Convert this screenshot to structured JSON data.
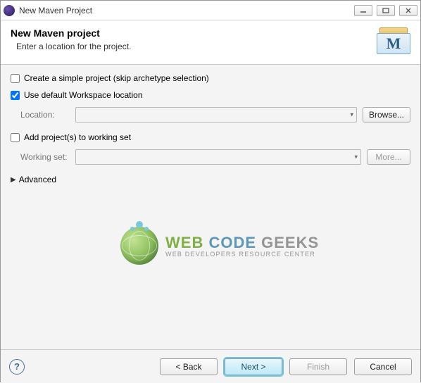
{
  "window": {
    "title": "New Maven Project"
  },
  "header": {
    "title": "New Maven project",
    "subtitle": "Enter a location for the project.",
    "icon_letter": "M"
  },
  "options": {
    "simple_project": {
      "label": "Create a simple project (skip archetype selection)",
      "checked": false
    },
    "default_workspace": {
      "label": "Use default Workspace location",
      "checked": true
    },
    "location": {
      "label": "Location:",
      "value": "",
      "browse": "Browse..."
    },
    "add_to_working_set": {
      "label": "Add project(s) to working set",
      "checked": false
    },
    "working_set": {
      "label": "Working set:",
      "value": "",
      "more": "More..."
    },
    "advanced": {
      "label": "Advanced"
    }
  },
  "watermark": {
    "brand_a": "WEB ",
    "brand_b": "CODE ",
    "brand_c": "GEEKS",
    "tagline": "WEB DEVELOPERS RESOURCE CENTER"
  },
  "footer": {
    "help": "?",
    "back": "< Back",
    "next": "Next >",
    "finish": "Finish",
    "cancel": "Cancel"
  }
}
